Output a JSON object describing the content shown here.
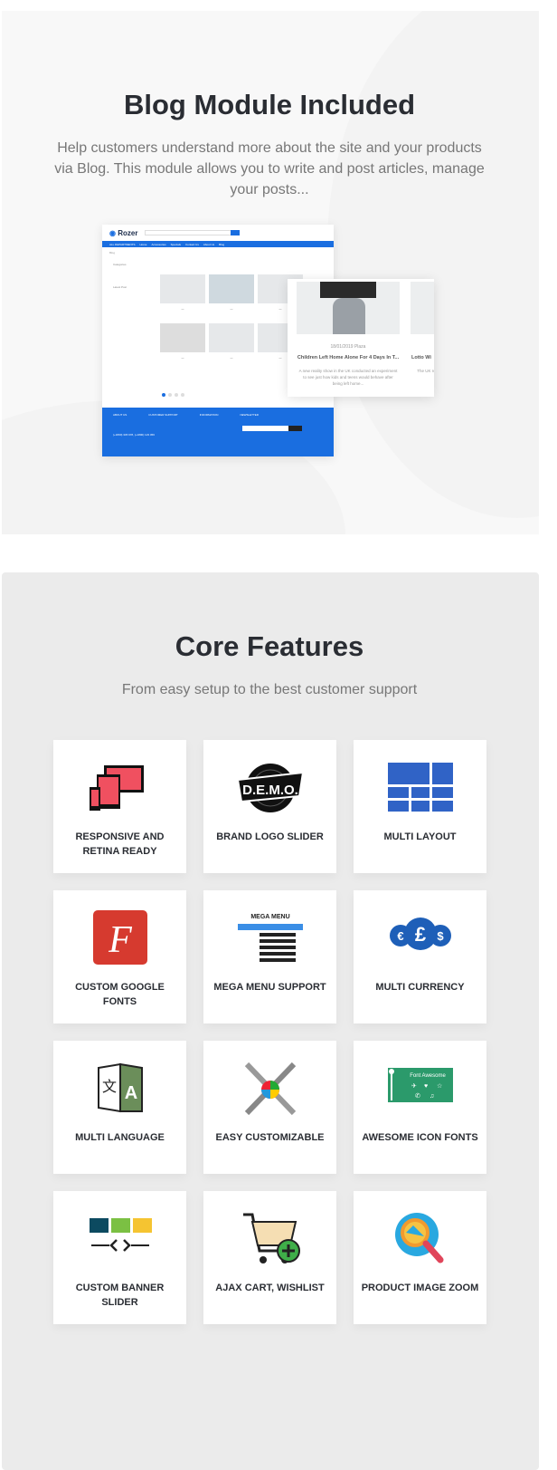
{
  "blog": {
    "title": "Blog Module Included",
    "description": "Help customers understand more about the site and your products via Blog. This module allows you to write and post articles, manage your posts...",
    "mockup": {
      "logo": "Rozer",
      "nav": [
        "ALL DEPARTMENTS",
        "Home",
        "Accessories",
        "Specials",
        "Contact Us",
        "About Us",
        "Blog"
      ],
      "breadcrumb": "Blog",
      "sidebar": [
        "Categories",
        "Latest Post"
      ],
      "footer_columns": [
        "ABOUT US",
        "CUSTOMER SUPPORT",
        "INFORMATION",
        "NEWSLETTER"
      ],
      "footer_phone": "(+1800) 345 678, (+1800) 123 456",
      "featured_post": {
        "meta": "18/01/2019  Plaza",
        "title": "Children Left Home Alone For 4 Days In T...",
        "excerpt": "A new reality show in the UK conducted an experiment to see just how kids and teens would behave after being left home...",
        "next_title": "Lotto Wi",
        "next_excerpt": "The UK revealed she"
      }
    }
  },
  "core": {
    "title": "Core Features",
    "subtitle": "From easy setup to the best customer support",
    "features": [
      {
        "label": "Responsive and Retina Ready",
        "icon": "responsive-devices-icon"
      },
      {
        "label": "Brand Logo Slider",
        "icon": "demo-logo-icon"
      },
      {
        "label": "Multi Layout",
        "icon": "layout-grid-icon"
      },
      {
        "label": "Custom Google Fonts",
        "icon": "font-icon"
      },
      {
        "label": "Mega Menu Support",
        "icon": "mega-menu-icon",
        "icon_text": "MEGA MENU"
      },
      {
        "label": "Multi Currency",
        "icon": "currency-icon"
      },
      {
        "label": "Multi Language",
        "icon": "language-icon"
      },
      {
        "label": "Easy Customizable",
        "icon": "tools-icon"
      },
      {
        "label": "Awesome Icon Fonts",
        "icon": "font-awesome-icon",
        "icon_text": "Font Awesome"
      },
      {
        "label": "Custom Banner Slider",
        "icon": "banner-slider-icon"
      },
      {
        "label": "Ajax Cart, Wishlist",
        "icon": "cart-add-icon"
      },
      {
        "label": "Product Image Zoom",
        "icon": "zoom-icon"
      }
    ]
  },
  "colors": {
    "brand_blue": "#1a6ee0",
    "heading": "#2a2d33",
    "panel": "#ebebeb"
  }
}
